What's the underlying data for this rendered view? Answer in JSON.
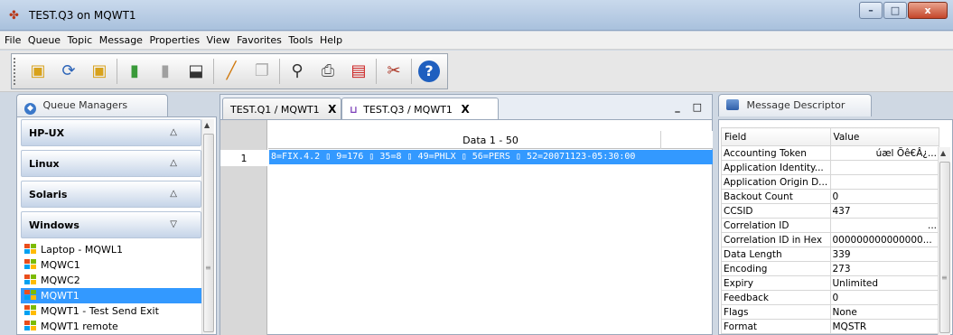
{
  "window": {
    "title": "TEST.Q3 on MQWT1",
    "app_icon": "app-logo-icon",
    "minimize_glyph": "–",
    "maximize_glyph": "□",
    "close_glyph": "x"
  },
  "menu": [
    "File",
    "Queue",
    "Topic",
    "Message",
    "Properties",
    "View",
    "Favorites",
    "Tools",
    "Help"
  ],
  "toolbar": {
    "icons": [
      {
        "name": "open-queue-icon",
        "glyph": "▣",
        "color": "#d8a21c"
      },
      {
        "name": "refresh-icon",
        "glyph": "⟳",
        "color": "#2c64b8"
      },
      {
        "name": "close-queue-icon",
        "glyph": "▣",
        "color": "#d8a21c"
      },
      {
        "name": "browse-icon",
        "glyph": "▮",
        "color": "#3a9a3a"
      },
      {
        "name": "get-icon",
        "glyph": "▮",
        "color": "#a0a0a0"
      },
      {
        "name": "put-icon",
        "glyph": "⬓",
        "color": "#333333"
      },
      {
        "name": "edit-icon",
        "glyph": "╱",
        "color": "#d07a10"
      },
      {
        "name": "copy-icon",
        "glyph": "❐",
        "color": "#b0b0b0"
      },
      {
        "name": "find-icon",
        "glyph": "⚲",
        "color": "#333333"
      },
      {
        "name": "print-icon",
        "glyph": "⎙",
        "color": "#555555"
      },
      {
        "name": "pdf-icon",
        "glyph": "▤",
        "color": "#cc2222"
      },
      {
        "name": "tools-icon",
        "glyph": "✂",
        "color": "#aa3322"
      },
      {
        "name": "help-icon",
        "glyph": "?",
        "color": "#1f5fbf"
      }
    ]
  },
  "queue_managers": {
    "tab_label": "Queue Managers",
    "groups": [
      {
        "label": "HP-UX",
        "caret": "△"
      },
      {
        "label": "Linux",
        "caret": "△"
      },
      {
        "label": "Solaris",
        "caret": "△"
      },
      {
        "label": "Windows",
        "caret": "▽"
      }
    ],
    "items": [
      {
        "label": "Laptop - MQWL1",
        "selected": false
      },
      {
        "label": "MQWC1",
        "selected": false
      },
      {
        "label": "MQWC2",
        "selected": false
      },
      {
        "label": "MQWT1",
        "selected": true
      },
      {
        "label": "MQWT1 - Test Send Exit",
        "selected": false
      },
      {
        "label": "MQWT1 remote",
        "selected": false
      }
    ]
  },
  "editor": {
    "tabs": [
      {
        "label": "TEST.Q1 / MQWT1",
        "close": "X"
      },
      {
        "label": "TEST.Q3 / MQWT1",
        "close": "X"
      }
    ],
    "window_controls": "_ □",
    "column_header": "Data 1 - 50",
    "rows": [
      {
        "num": "1",
        "data": "8=FIX.4.2 ▯ 9=176 ▯ 35=8 ▯ 49=PHLX ▯ 56=PERS ▯ 52=20071123-05:30:00"
      }
    ]
  },
  "message_descriptor": {
    "tab_label": "Message Descriptor",
    "columns": [
      "Field",
      "Value"
    ],
    "rows": [
      {
        "field": "Accounting Token",
        "value": "úæl Õê€Â¿...",
        "align": "right"
      },
      {
        "field": "Application Identity...",
        "value": "",
        "align": "left"
      },
      {
        "field": "Application Origin D...",
        "value": "",
        "align": "left"
      },
      {
        "field": "Backout Count",
        "value": "0",
        "align": "left"
      },
      {
        "field": "CCSID",
        "value": "437",
        "align": "left"
      },
      {
        "field": "Correlation ID",
        "value": "...",
        "align": "right"
      },
      {
        "field": "Correlation ID in Hex",
        "value": "000000000000000...",
        "align": "left"
      },
      {
        "field": "Data Length",
        "value": "339",
        "align": "left"
      },
      {
        "field": "Encoding",
        "value": "273",
        "align": "left"
      },
      {
        "field": "Expiry",
        "value": "Unlimited",
        "align": "left"
      },
      {
        "field": "Feedback",
        "value": "0",
        "align": "left"
      },
      {
        "field": "Flags",
        "value": "None",
        "align": "left"
      },
      {
        "field": "Format",
        "value": "MQSTR",
        "align": "left"
      }
    ]
  },
  "colors": {
    "selection": "#3399ff",
    "titlebar": "#b9cde6"
  }
}
